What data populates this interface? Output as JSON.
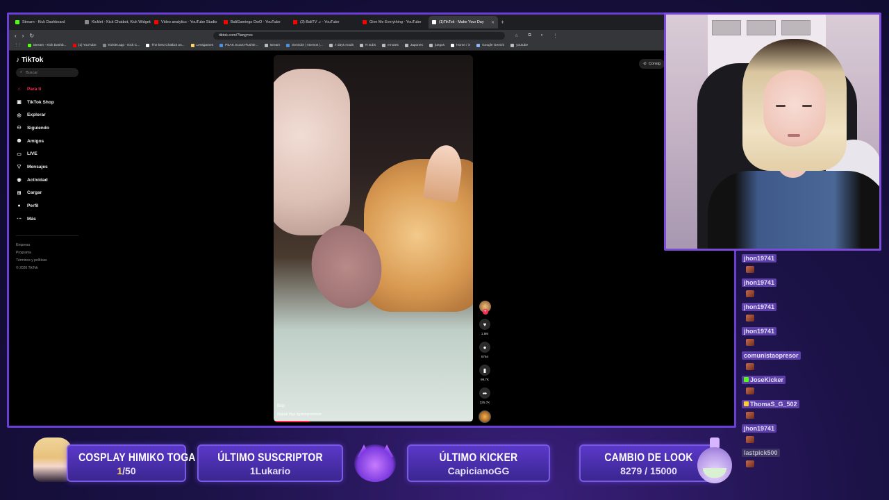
{
  "browser": {
    "tabs": [
      {
        "label": "Stream - Kick Dashboard",
        "color": "#53fc18"
      },
      {
        "label": "Kicklet - Kick Chatbot, Kick Widgets",
        "color": "#888888"
      },
      {
        "label": "Video analytics - YouTube Studio",
        "color": "#ff0000"
      },
      {
        "label": "BaliGamings OwO - YouTube",
        "color": "#ff0000"
      },
      {
        "label": "(3) BaliTV ♫ - YouTube",
        "color": "#ff0000"
      },
      {
        "label": "Give Me Everything - YouTube",
        "color": "#ff0000"
      },
      {
        "label": "(1)TikTok - Make Your Day",
        "color": "#ffffff",
        "active": true
      }
    ],
    "new_tab": "+",
    "tab_close": "✕",
    "url": "tiktok.com/?lang=es",
    "bookmarks": [
      {
        "label": "Stream - Kick Dashb...",
        "color": "#53fc18"
      },
      {
        "label": "(1) YouTube",
        "color": "#ff0000"
      },
      {
        "label": "Kicklet.app - Kick C...",
        "color": "#888888"
      },
      {
        "label": "The best Chatbot an...",
        "color": "#ffffff"
      },
      {
        "label": "Lessgames",
        "color": "#ffd36b"
      },
      {
        "label": "PEAK Scout Plushie...",
        "color": "#4a90e2"
      },
      {
        "label": "stream",
        "color": "#bbbbbb"
      },
      {
        "label": "Servidor | Aternos |...",
        "color": "#4a90e2"
      },
      {
        "label": "7 days mods",
        "color": "#bbbbbb"
      },
      {
        "label": "R subs",
        "color": "#bbbbbb"
      },
      {
        "label": "emotes",
        "color": "#bbbbbb"
      },
      {
        "label": "Japones",
        "color": "#bbbbbb"
      },
      {
        "label": "juegos",
        "color": "#bbbbbb"
      },
      {
        "label": "Home / X",
        "color": "#ffffff"
      },
      {
        "label": "Google Gemini",
        "color": "#8ab4f8"
      },
      {
        "label": "youtube",
        "color": "#bbbbbb"
      }
    ]
  },
  "tiktok": {
    "brand": "TikTok",
    "search_placeholder": "Buscar",
    "nav": [
      {
        "label": "Para ti",
        "icon": "home-icon",
        "glyph": "⌂",
        "active": true
      },
      {
        "label": "TikTok Shop",
        "icon": "shop-icon",
        "glyph": "▣"
      },
      {
        "label": "Explorar",
        "icon": "compass-icon",
        "glyph": "◎"
      },
      {
        "label": "Siguiendo",
        "icon": "following-icon",
        "glyph": "⚇"
      },
      {
        "label": "Amigos",
        "icon": "friends-icon",
        "glyph": "⚉"
      },
      {
        "label": "LIVE",
        "icon": "live-icon",
        "glyph": "▭"
      },
      {
        "label": "Mensajes",
        "icon": "messages-icon",
        "glyph": "▽"
      },
      {
        "label": "Actividad",
        "icon": "activity-icon",
        "glyph": "◉"
      },
      {
        "label": "Cargar",
        "icon": "upload-icon",
        "glyph": "⊞"
      },
      {
        "label": "Perfil",
        "icon": "profile-icon",
        "glyph": "●"
      },
      {
        "label": "Más",
        "icon": "more-icon",
        "glyph": "⋯"
      }
    ],
    "footer": [
      "Empresa",
      "Programa",
      "Términos y políticas",
      "© 2026 TikTok"
    ],
    "coins_label": "Consig",
    "video": {
      "author": "Brip",
      "tags": "#parati #fyp #gatosgraciosos",
      "progress": 0.18
    },
    "actions": {
      "likes": "1.5M",
      "comments": "5764",
      "saves": "99.7K",
      "shares": "325.7K"
    }
  },
  "chat": [
    {
      "user": "jhon19741",
      "emote": true
    },
    {
      "user": "jhon19741",
      "emote": true
    },
    {
      "user": "jhon19741",
      "emote": true
    },
    {
      "user": "jhon19741",
      "emote": true
    },
    {
      "user": "comunistaopresor",
      "emote": true
    },
    {
      "user": "JoseKicker",
      "badge": "#53fc18",
      "emote": true
    },
    {
      "user": "ThomaS_G_502",
      "badge": "#ffcc33",
      "emote": true
    },
    {
      "user": "jhon19741",
      "emote": true
    },
    {
      "user": "lastpick500",
      "gray": true,
      "emote": true
    }
  ],
  "widgets": {
    "cosplay": {
      "title": "COSPLAY HIMIKO TOGA",
      "current": "1",
      "goal": "/50"
    },
    "last_sub": {
      "title": "ÚLTIMO SUSCRIPTOR",
      "value": "1Lukario"
    },
    "last_kicker": {
      "title": "ÚLTIMO KICKER",
      "value": "CapicianoGG"
    },
    "look_change": {
      "title": "CAMBIO DE LOOK",
      "value": "8279 / 15000"
    }
  }
}
